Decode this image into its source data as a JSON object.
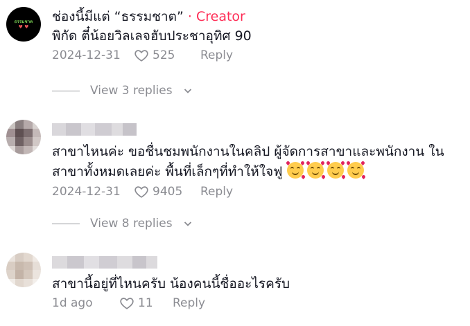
{
  "comments": [
    {
      "author": "ช่องนี้มีแต่ “ธรรมชาต”",
      "separator": " · ",
      "badge": "Creator",
      "avatar_text": "ธรรมชาต",
      "text": "พิกัด ตี๋น้อยวิลเลจฮับประชาอุทิศ 90",
      "date": "2024-12-31",
      "likes": "525",
      "reply_label": "Reply",
      "view_replies": "View 3 replies"
    },
    {
      "text": "สาขาไหนค่ะ ขอชื่นชมพนักงานในคลิป ผู้จัดการสาขาและพนักงาน ในสาขาทั้งหมดเลยค่ะ พื้นที่เล็กๆที่ทำให้ใจฟู",
      "emoji_icon": "smiling-face-with-hearts-icon",
      "date": "2024-12-31",
      "likes": "9405",
      "reply_label": "Reply",
      "view_replies": "View 8 replies"
    },
    {
      "text": "สาขานี้อยู่ที่ไหนครับ น้องคนนี้ชื่ออะไรครับ",
      "date": "1d ago",
      "likes": "11",
      "reply_label": "Reply"
    }
  ],
  "colors": {
    "creator_badge": "#fe2c55",
    "meta_text": "#8a8b91"
  }
}
